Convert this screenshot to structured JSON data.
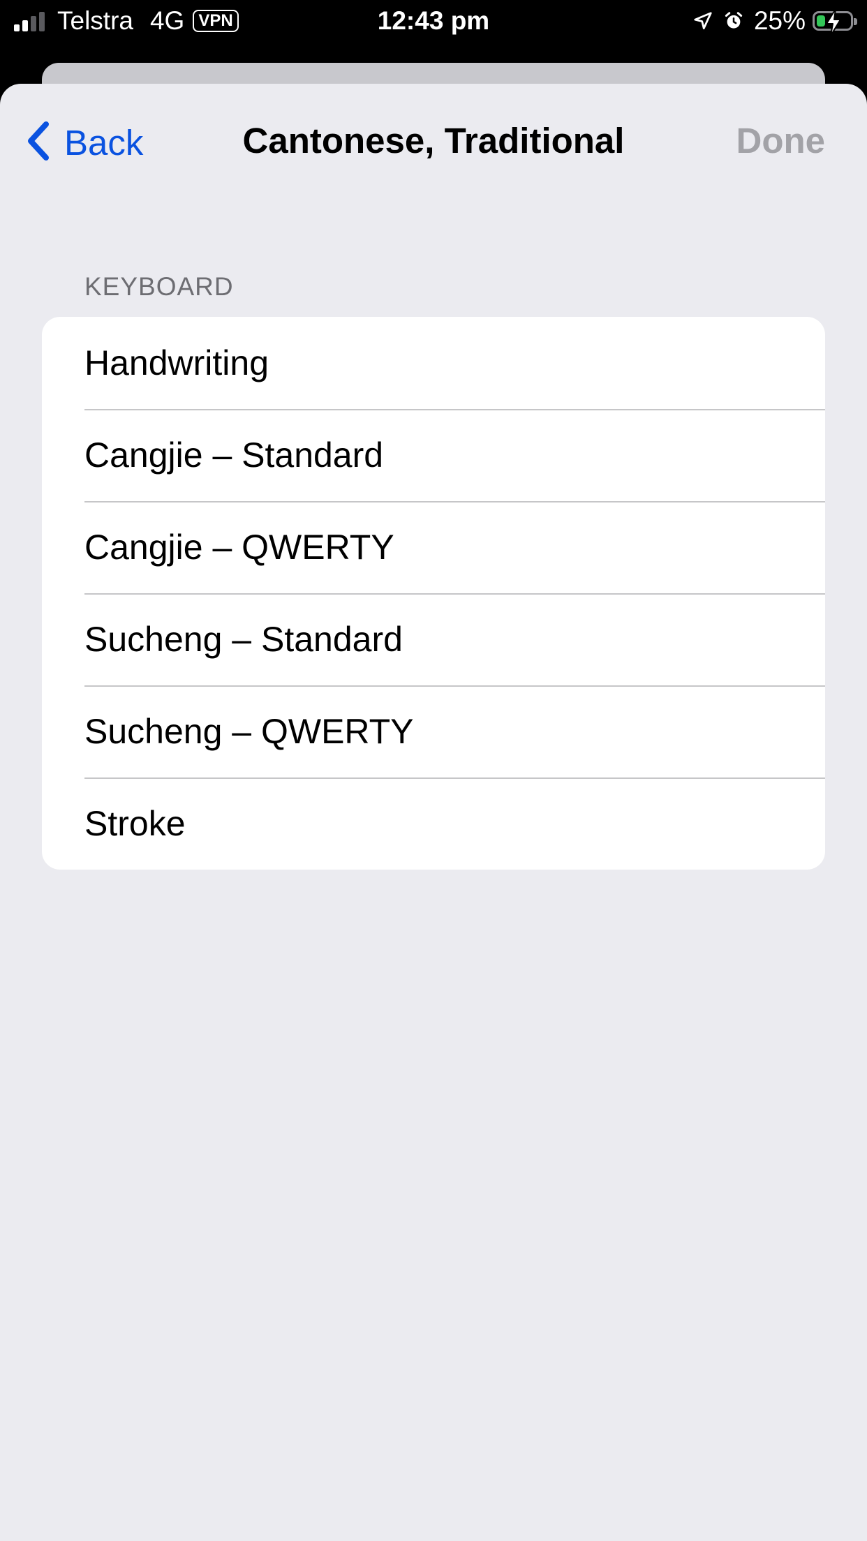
{
  "status_bar": {
    "carrier": "Telstra",
    "network": "4G",
    "vpn": "VPN",
    "time": "12:43 pm",
    "battery_percent": "25%",
    "battery_level": 0.25,
    "icons": [
      "signal-icon",
      "location-arrow-icon",
      "alarm-icon",
      "battery-charging-icon"
    ],
    "colors": {
      "battery_fill": "#34c759"
    }
  },
  "nav": {
    "back_label": "Back",
    "title": "Cantonese, Traditional",
    "done_label": "Done"
  },
  "keyboard_section": {
    "header": "KEYBOARD",
    "items": [
      {
        "label": "Handwriting"
      },
      {
        "label": "Cangjie – Standard"
      },
      {
        "label": "Cangjie – QWERTY"
      },
      {
        "label": "Sucheng – Standard"
      },
      {
        "label": "Sucheng – QWERTY"
      },
      {
        "label": "Stroke"
      }
    ]
  },
  "colors": {
    "accent": "#0a52e0",
    "sheet_background": "#ebebf0",
    "disabled_text": "#a2a2a7"
  }
}
